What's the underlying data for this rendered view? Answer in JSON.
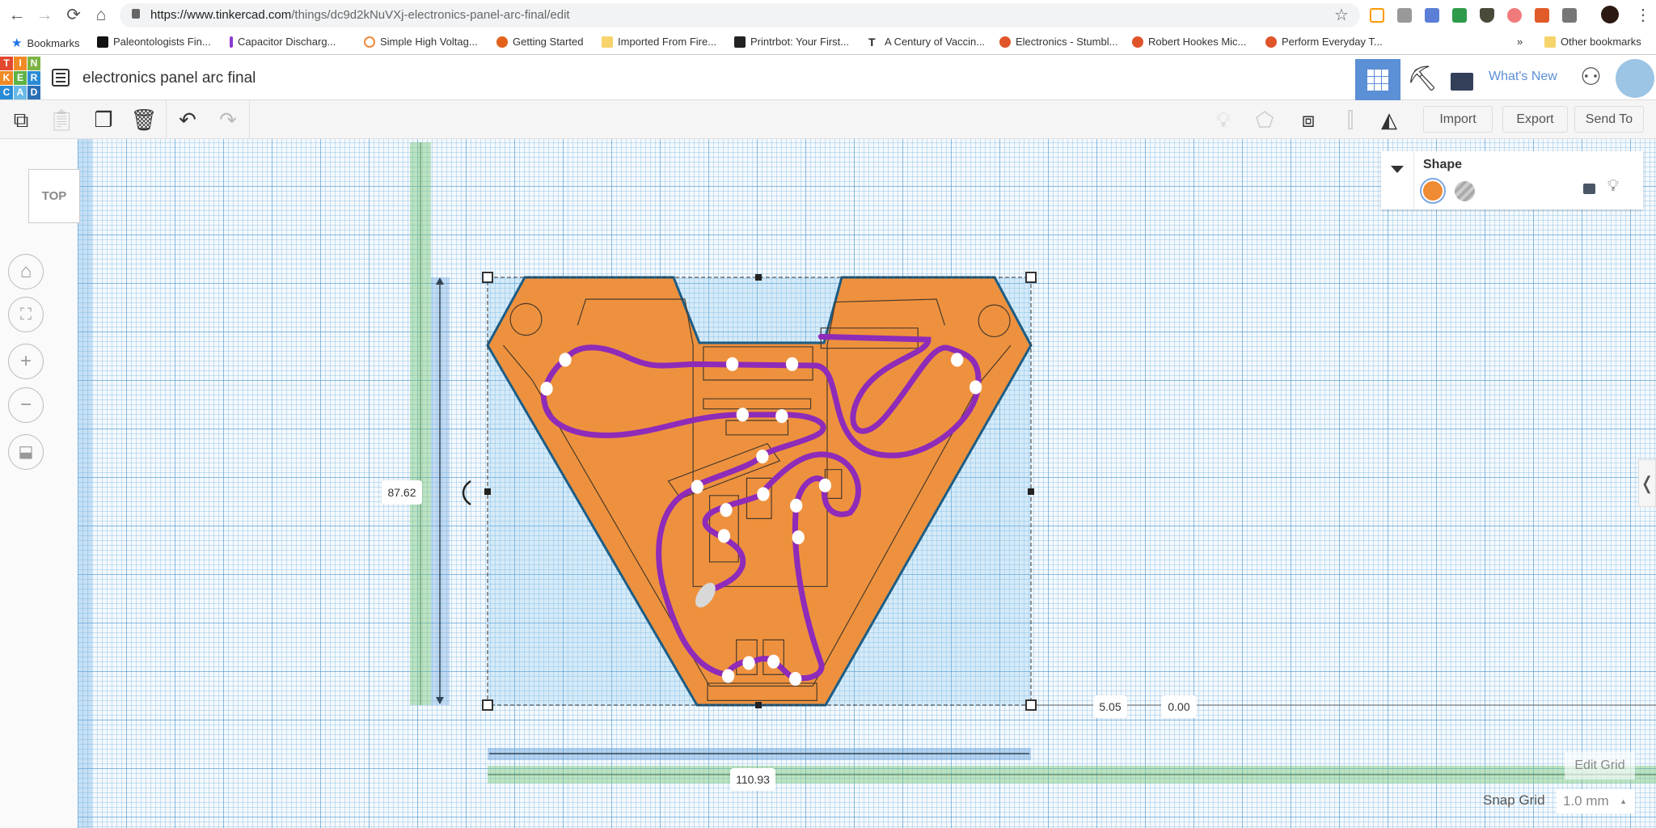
{
  "browser": {
    "url_host": "https://www.tinkercad.com",
    "url_path": "/things/dc9d2kNuVXj-electronics-panel-arc-final/edit",
    "bookmarks": [
      {
        "label": "Bookmarks",
        "color": "#1a73e8"
      },
      {
        "label": "Paleontologists Fin...",
        "color": "#111"
      },
      {
        "label": "Capacitor Discharg...",
        "color": "#8a3bd1"
      },
      {
        "label": "Simple High Voltag...",
        "color": "#f08a3c"
      },
      {
        "label": "Getting Started",
        "color": "#e2621b"
      },
      {
        "label": "Imported From Fire...",
        "color": "#f6d36b"
      },
      {
        "label": "Printrbot: Your First...",
        "color": "#222"
      },
      {
        "label": "A Century of Vaccin...",
        "color": "#333"
      },
      {
        "label": "Electronics - Stumbl...",
        "color": "#e0542a"
      },
      {
        "label": "Robert Hookes Mic...",
        "color": "#e0542a"
      },
      {
        "label": "Perform Everyday T...",
        "color": "#e0542a"
      }
    ],
    "more_bookmarks": "»",
    "other_bookmarks": "Other bookmarks"
  },
  "app": {
    "logo_letters": [
      "T",
      "I",
      "N",
      "K",
      "E",
      "R",
      "C",
      "A",
      "D"
    ],
    "logo_colors": [
      "#e2482f",
      "#f08a24",
      "#7cb342",
      "#f08a24",
      "#5eb244",
      "#2a8bd6",
      "#2a8bd6",
      "#6ab9e7",
      "#2a6fb5"
    ],
    "design_title": "electronics panel arc final",
    "whats_new": "What's New",
    "accent": "#5b8fd6"
  },
  "toolbar": {
    "import": "Import",
    "export": "Export",
    "send_to": "Send To"
  },
  "view": {
    "cube_label": "TOP"
  },
  "shape_panel": {
    "title": "Shape",
    "solid_color": "#ef8b33",
    "hole_color": "#aaaaaa"
  },
  "dimensions": {
    "height": "87.62",
    "width": "110.93",
    "elevation_offset": "5.05",
    "elevation": "0.00"
  },
  "grid": {
    "edit_grid": "Edit Grid",
    "snap_label": "Snap Grid",
    "snap_value": "1.0 mm"
  },
  "colors": {
    "shape_fill": "#ee913e",
    "wire": "#8e2bb8"
  }
}
